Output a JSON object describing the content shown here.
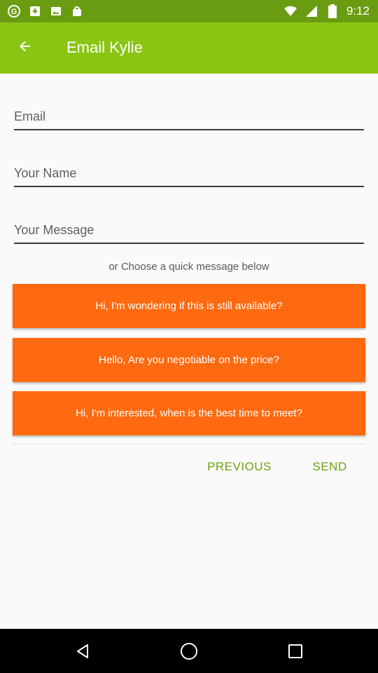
{
  "status_bar": {
    "time": "9:12",
    "left_icons": [
      "google-icon",
      "download-icon",
      "image-icon",
      "bag-icon"
    ],
    "right_icons": [
      "wifi-icon",
      "signal-icon",
      "battery-icon"
    ]
  },
  "app_bar": {
    "title": "Email Kylie",
    "back_icon": "arrow-left-icon",
    "color": "#8bc514"
  },
  "form": {
    "email": {
      "value": "",
      "placeholder": "Email"
    },
    "name": {
      "value": "",
      "placeholder": "Your Name"
    },
    "message": {
      "value": "",
      "placeholder": "Your Message"
    }
  },
  "quick_hint": "or Choose a quick message below",
  "quick_messages": [
    "Hi, I'm wondering if this is still available?",
    "Hello, Are you negotiable on the price?",
    "Hi, I'm interested, when is the best time to meet?"
  ],
  "quick_color": "#ff6a10",
  "actions": {
    "previous": "PREVIOUS",
    "send": "SEND",
    "color": "#6aa30e"
  },
  "nav_bar": {
    "icons": [
      "back-triangle-icon",
      "home-circle-icon",
      "recents-square-icon"
    ]
  }
}
